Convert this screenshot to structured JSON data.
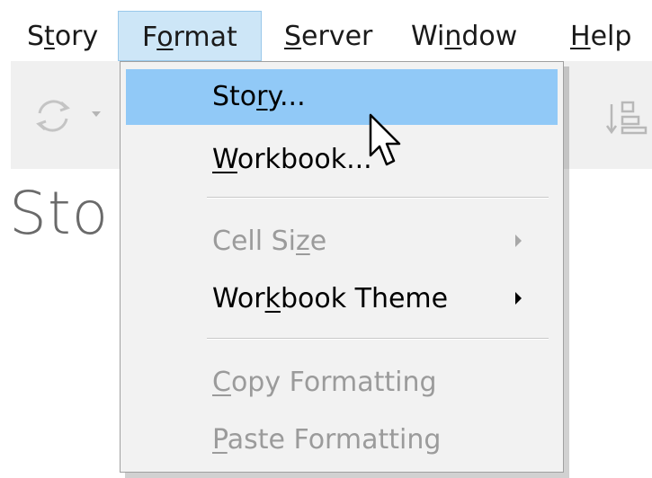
{
  "menubar": {
    "items": [
      {
        "pre": "S",
        "u": "t",
        "post": "ory"
      },
      {
        "pre": "F",
        "u": "o",
        "post": "rmat"
      },
      {
        "pre": "",
        "u": "S",
        "post": "erver"
      },
      {
        "pre": "Wi",
        "u": "n",
        "post": "dow"
      },
      {
        "pre": "",
        "u": "H",
        "post": "elp"
      }
    ]
  },
  "content": {
    "heading": "Sto"
  },
  "format_menu": {
    "story": {
      "pre": "Sto",
      "u": "r",
      "post": "y..."
    },
    "workbook": {
      "pre": "",
      "u": "W",
      "post": "orkbook..."
    },
    "cell_size": {
      "pre": "Cell Si",
      "u": "z",
      "post": "e"
    },
    "workbook_theme": {
      "pre": "Wor",
      "u": "k",
      "post": "book Theme"
    },
    "copy_formatting": {
      "pre": "",
      "u": "C",
      "post": "opy Formatting"
    },
    "paste_formatting": {
      "pre": "",
      "u": "P",
      "post": "aste Formatting"
    }
  },
  "colors": {
    "highlight": "#91c9f7",
    "active_menubar": "#cde6f7",
    "disabled_text": "#9b9b9b"
  },
  "icons": [
    "refresh-icon",
    "dropdown-caret-icon",
    "sort-icon",
    "submenu-arrow-icon",
    "mouse-cursor-icon"
  ]
}
